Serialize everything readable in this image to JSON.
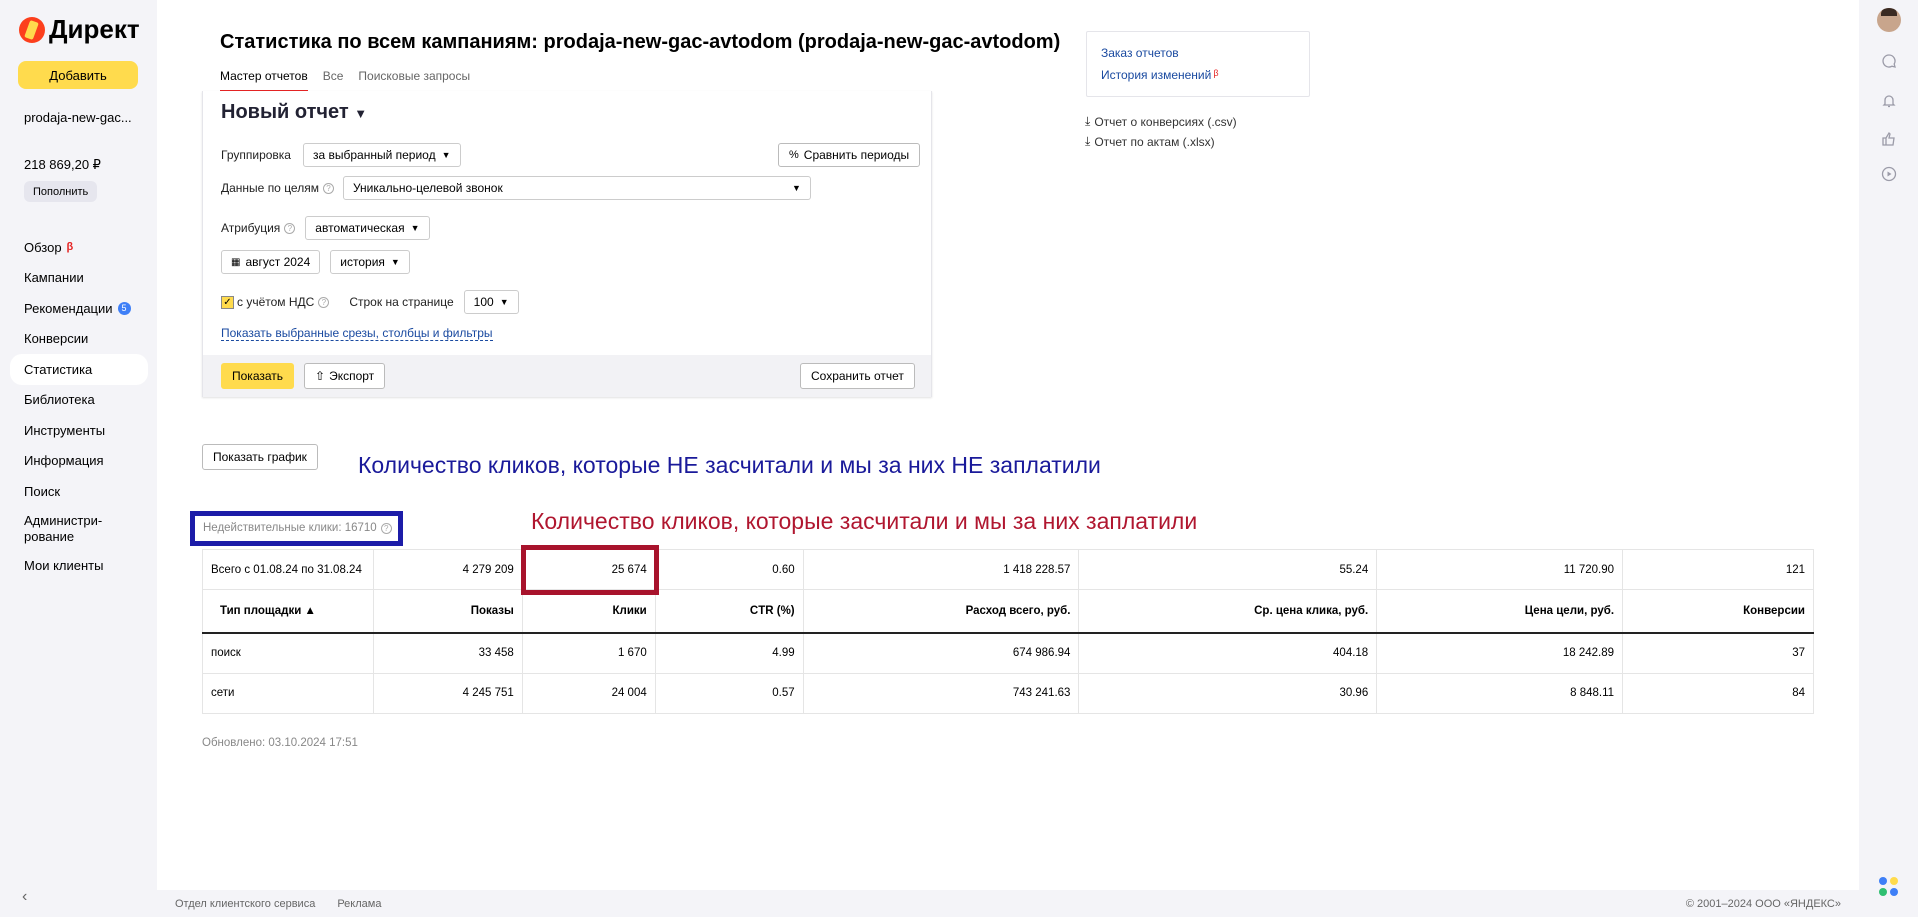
{
  "sidebar": {
    "logo": "Директ",
    "add_button": "Добавить",
    "account": "prodaja-new-gac...",
    "balance": "218 869,20 ₽",
    "topup": "Пополнить",
    "nav": [
      {
        "label": "Обзор",
        "beta": "β"
      },
      {
        "label": "Кампании"
      },
      {
        "label": "Рекомендации",
        "badge": "5"
      },
      {
        "label": "Конверсии"
      },
      {
        "label": "Статистика"
      },
      {
        "label": "Библиотека"
      },
      {
        "label": "Инструменты"
      },
      {
        "label": "Информация"
      },
      {
        "label": "Поиск"
      },
      {
        "label": "Администри-\nрование"
      },
      {
        "label": "Мои клиенты"
      }
    ],
    "collapse": "‹"
  },
  "header": {
    "title": "Статистика по всем кампаниям: prodaja-new-gac-avtodom (prodaja-new-gac-avtodom)",
    "tabs": [
      "Мастер отчетов",
      "Все",
      "Поисковые запросы"
    ]
  },
  "report": {
    "title": "Новый отчет",
    "title_caret": "▼",
    "grouping_label": "Группировка",
    "grouping_value": "за выбранный период",
    "compare_button": "Сравнить периоды",
    "goals_label": "Данные по целям",
    "goals_value": "Уникально-целевой звонок",
    "attribution_label": "Атрибуция",
    "attribution_value": "автоматическая",
    "period_value": "август 2024",
    "history_value": "история",
    "vat_label": "с учётом НДС",
    "rows_label": "Строк на странице",
    "rows_value": "100",
    "show_filters_link": "Показать выбранные срезы, столбцы и фильтры",
    "show_button": "Показать",
    "export_button": "Экспорт",
    "save_button": "Сохранить отчет"
  },
  "side_links": {
    "order_reports": "Заказ отчетов",
    "history": "История изменений",
    "history_beta": "β",
    "conversions_csv": "Отчет о конверсиях (.csv)",
    "acts_xlsx": "Отчет по актам (.xlsx)"
  },
  "show_chart": "Показать график",
  "annotations": {
    "blue": "Количество кликов, которые НЕ засчитали и мы за них НЕ заплатили",
    "red": "Количество кликов, которые засчитали и мы за них заплатили"
  },
  "invalid_clicks": "Недействительные клики: 16710",
  "table": {
    "total": [
      "Всего с 01.08.24 по 31.08.24",
      "4 279 209",
      "25 674",
      "0.60",
      "1 418 228.57",
      "55.24",
      "11 720.90",
      "121"
    ],
    "headers": [
      "Тип площадки ▲",
      "Показы",
      "Клики",
      "CTR (%)",
      "Расход всего, руб.",
      "Ср. цена клика, руб.",
      "Цена цели, руб.",
      "Конверсии"
    ],
    "rows": [
      [
        "поиск",
        "33 458",
        "1 670",
        "4.99",
        "674 986.94",
        "404.18",
        "18 242.89",
        "37"
      ],
      [
        "сети",
        "4 245 751",
        "24 004",
        "0.57",
        "743 241.63",
        "30.96",
        "8 848.11",
        "84"
      ]
    ]
  },
  "updated": "Обновлено: 03.10.2024 17:51",
  "footer": {
    "links": [
      "Отдел клиентского сервиса",
      "Реклама"
    ],
    "copyright": "© 2001–2024 ООО «ЯНДЕКС»"
  },
  "colors": {
    "accent_yellow": "#ffdb4d",
    "annotation_blue": "#1c1ca8",
    "annotation_red": "#a8132c",
    "link": "#1a4aa0"
  }
}
